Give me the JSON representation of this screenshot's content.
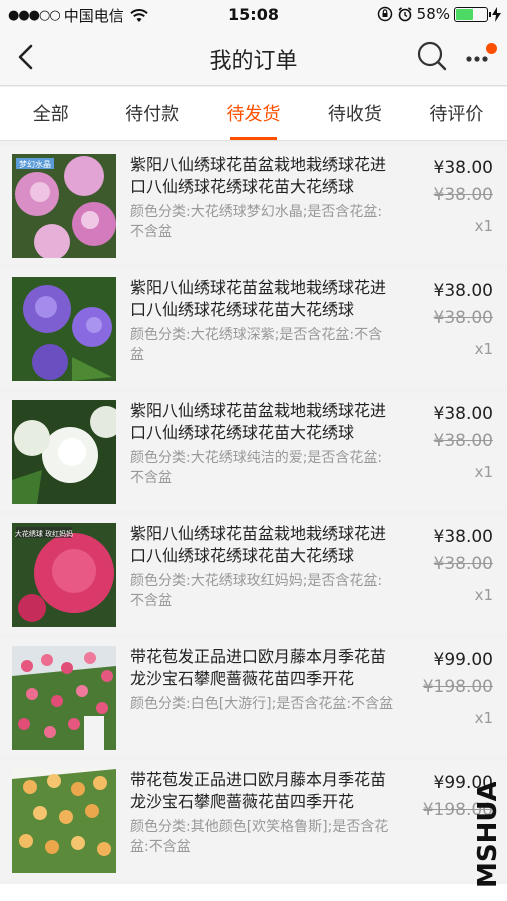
{
  "status": {
    "signal": "●●●○○",
    "carrier": "中国电信",
    "time": "15:08",
    "battery": "58%",
    "battery_level": 0.58
  },
  "nav": {
    "title": "我的订单"
  },
  "tabs": [
    {
      "label": "全部",
      "active": false
    },
    {
      "label": "待付款",
      "active": false
    },
    {
      "label": "待发货",
      "active": true
    },
    {
      "label": "待收货",
      "active": false
    },
    {
      "label": "待评价",
      "active": false
    }
  ],
  "orders": [
    {
      "name": "紫阳八仙绣球花苗盆栽地栽绣球花进口八仙绣球花绣球花苗大花绣球",
      "spec": "颜色分类:大花绣球梦幻水晶;是否含花盆:不含盆",
      "price": "¥38.00",
      "original_price": "¥38.00",
      "qty": "x1",
      "image_label": "梦幻水晶"
    },
    {
      "name": "紫阳八仙绣球花苗盆栽地栽绣球花进口八仙绣球花绣球花苗大花绣球",
      "spec": "颜色分类:大花绣球深紫;是否含花盆:不含盆",
      "price": "¥38.00",
      "original_price": "¥38.00",
      "qty": "x1",
      "image_label": ""
    },
    {
      "name": "紫阳八仙绣球花苗盆栽地栽绣球花进口八仙绣球花绣球花苗大花绣球",
      "spec": "颜色分类:大花绣球纯洁的爱;是否含花盆:不含盆",
      "price": "¥38.00",
      "original_price": "¥38.00",
      "qty": "x1",
      "image_label": ""
    },
    {
      "name": "紫阳八仙绣球花苗盆栽地栽绣球花进口八仙绣球花绣球花苗大花绣球",
      "spec": "颜色分类:大花绣球玫红妈妈;是否含花盆:不含盆",
      "price": "¥38.00",
      "original_price": "¥38.00",
      "qty": "x1",
      "image_label": "大花绣球 玫红妈妈"
    },
    {
      "name": "带花苞发正品进口欧月藤本月季花苗龙沙宝石攀爬蔷薇花苗四季开花",
      "spec": "颜色分类:白色[大游行];是否含花盆:不含盆",
      "price": "¥99.00",
      "original_price": "¥198.00",
      "qty": "x1",
      "image_label": ""
    },
    {
      "name": "带花苞发正品进口欧月藤本月季花苗龙沙宝石攀爬蔷薇花苗四季开花",
      "spec": "颜色分类:其他颜色[欢笑格鲁斯];是否含花盆:不含盆",
      "price": "¥99.00",
      "original_price": "¥198.00",
      "qty": "",
      "image_label": ""
    }
  ],
  "watermark": "MSHUA",
  "colors": {
    "accent": "#ff5000",
    "battery": "#4cd964"
  }
}
